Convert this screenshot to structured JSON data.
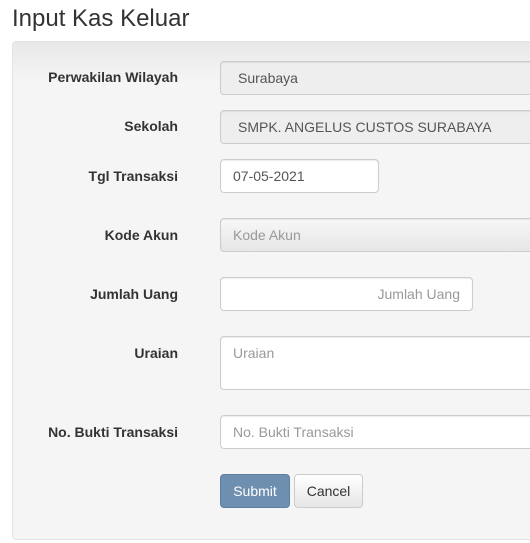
{
  "page": {
    "title": "Input Kas Keluar"
  },
  "form": {
    "wilayah": {
      "label": "Perwakilan Wilayah",
      "value": "Surabaya"
    },
    "sekolah": {
      "label": "Sekolah",
      "value": "SMPK. ANGELUS CUSTOS SURABAYA"
    },
    "tgl_transaksi": {
      "label": "Tgl Transaksi",
      "value": "07-05-2021"
    },
    "kode_akun": {
      "label": "Kode Akun",
      "placeholder": "Kode Akun"
    },
    "jumlah_uang": {
      "label": "Jumlah Uang",
      "placeholder": "Jumlah Uang"
    },
    "uraian": {
      "label": "Uraian",
      "placeholder": "Uraian"
    },
    "no_bukti": {
      "label": "No. Bukti Transaksi",
      "placeholder": "No. Bukti Transaksi"
    }
  },
  "actions": {
    "submit_label": "Submit",
    "cancel_label": "Cancel"
  }
}
